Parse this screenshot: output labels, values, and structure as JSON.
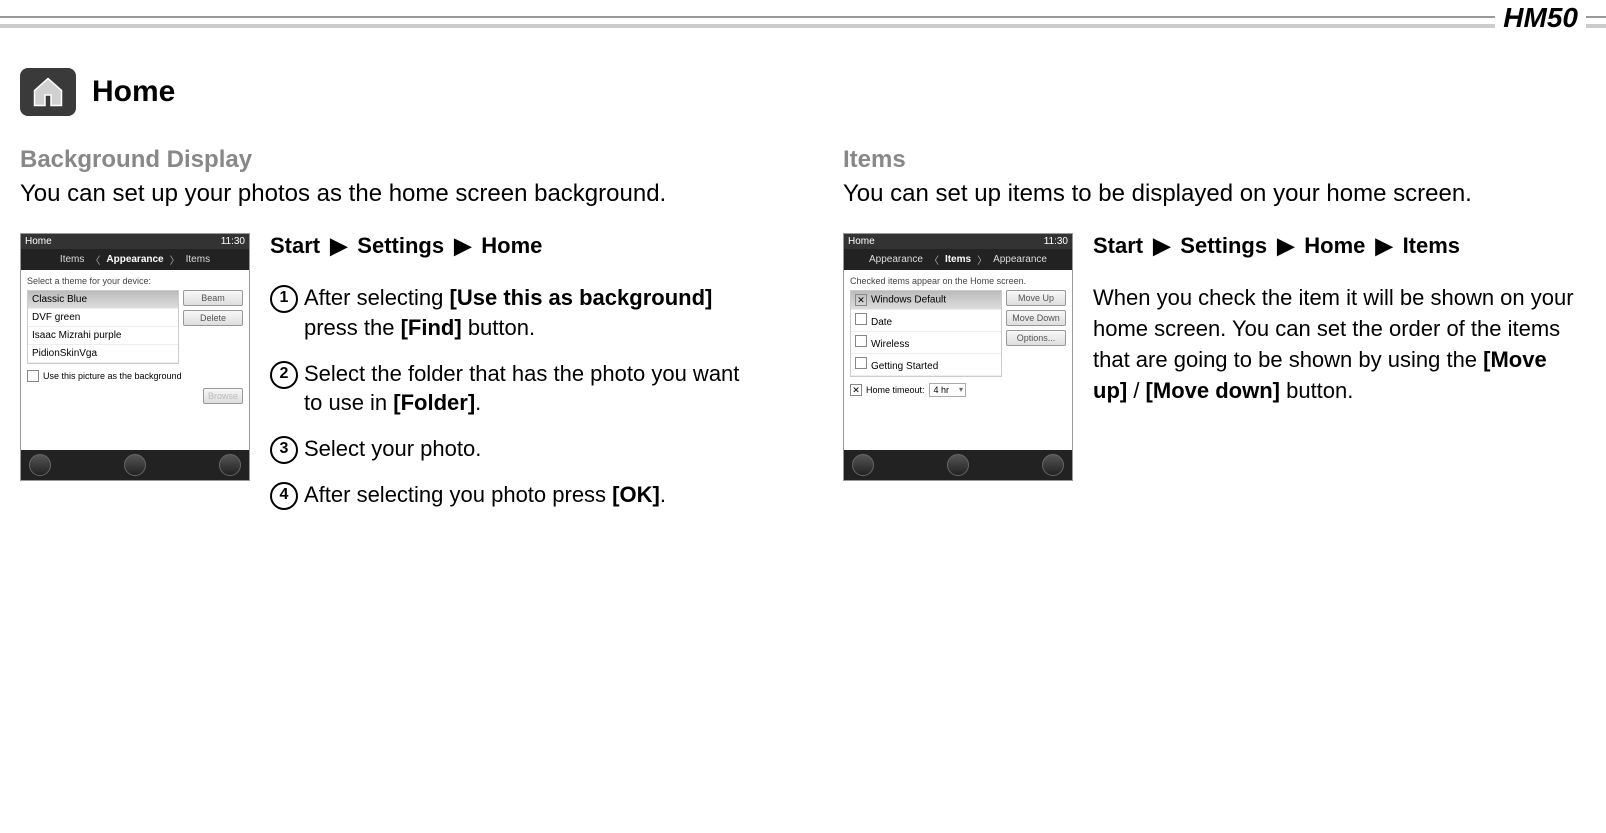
{
  "model": "HM50",
  "section": {
    "icon": "home-icon",
    "title": "Home"
  },
  "left": {
    "subhead": "Background Display",
    "lead": "You can set up your photos as the home screen background.",
    "path": {
      "p1": "Start",
      "p2": "Settings",
      "p3": "Home"
    },
    "steps": {
      "s1a": "After selecting ",
      "s1b": "[Use this as background]",
      "s1c": " press the ",
      "s1d": "[Find]",
      "s1e": " button.",
      "s2a": "Select the folder that has the photo you want to use in ",
      "s2b": "[Folder]",
      "s2c": ".",
      "s3": "Select your photo.",
      "s4a": "After selecting you photo press ",
      "s4b": "[OK]",
      "s4c": "."
    },
    "screenshot": {
      "status_left": "Home",
      "status_right": "11:30",
      "tab_left": "Items",
      "tab_center": "Appearance",
      "tab_right": "Items",
      "hint": "Select a theme for your device:",
      "themes": {
        "t1": "Classic Blue",
        "t2": "DVF green",
        "t3": "Isaac Mizrahi purple",
        "t4": "PidionSkinVga"
      },
      "btn_beam": "Beam",
      "btn_delete": "Delete",
      "check_label": "Use this picture as the background",
      "btn_browse": "Browse"
    }
  },
  "right": {
    "subhead": "Items",
    "lead": "You can set up items to be displayed on your home screen.",
    "path": {
      "p1": "Start",
      "p2": "Settings",
      "p3": "Home",
      "p4": "Items"
    },
    "desc_a": "When you check the item it will be shown on your home screen. You can set the order of the items that are going to be shown by using the ",
    "desc_b": "[Move up]",
    "desc_c": " / ",
    "desc_d": "[Move down]",
    "desc_e": " button.",
    "screenshot": {
      "status_left": "Home",
      "status_right": "11:30",
      "tab_left": "Appearance",
      "tab_center": "Items",
      "tab_right": "Appearance",
      "hint": "Checked items appear on the Home screen.",
      "items": {
        "i1": "Windows Default",
        "i2": "Date",
        "i3": "Wireless",
        "i4": "Getting Started"
      },
      "btn_up": "Move Up",
      "btn_down": "Move Down",
      "btn_opts": "Options...",
      "timeout_label": "Home timeout:",
      "timeout_val": "4 hr"
    }
  }
}
